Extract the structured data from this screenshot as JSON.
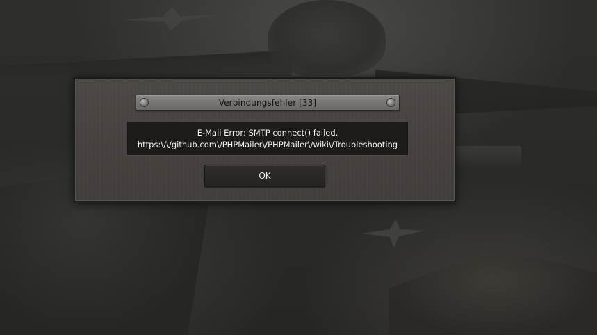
{
  "dialog": {
    "title": "Verbindungsfehler [33]",
    "message_line1": "E-Mail Error: SMTP connect() failed.",
    "message_line2": "https:\\/\\/github.com\\/PHPMailer\\/PHPMailer\\/wiki\\/Troubleshooting",
    "ok_label": "OK"
  },
  "colors": {
    "dialog_background": "#47423f",
    "title_bar": "#7a7875",
    "message_background": "#1d1c1b",
    "button_background": "#2a2928"
  }
}
